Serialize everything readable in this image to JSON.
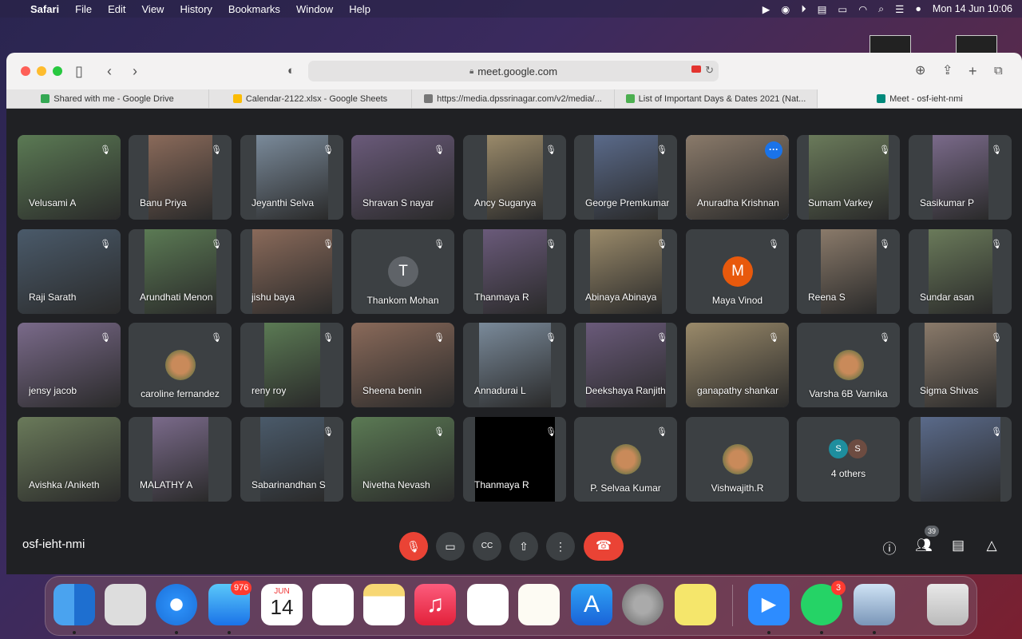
{
  "menubar": {
    "app": "Safari",
    "items": [
      "File",
      "Edit",
      "View",
      "History",
      "Bookmarks",
      "Window",
      "Help"
    ],
    "datetime": "Mon 14 Jun  10:06"
  },
  "browser": {
    "url": "meet.google.com",
    "tabs": [
      {
        "label": "Shared with me - Google Drive",
        "color": "#34a853"
      },
      {
        "label": "Calendar-2122.xlsx - Google Sheets",
        "color": "#fbbc04"
      },
      {
        "label": "https://media.dpssrinagar.com/v2/media/...",
        "color": "#777777"
      },
      {
        "label": "List of Important Days & Dates 2021 (Nat...",
        "color": "#4caf50"
      },
      {
        "label": "Meet - osf-ieht-nmi",
        "color": "#00897b"
      }
    ]
  },
  "meet": {
    "code": "osf-ieht-nmi",
    "participant_count": "39",
    "participants": [
      {
        "name": "Velusami A"
      },
      {
        "name": "Banu Priya"
      },
      {
        "name": "Jeyanthi Selva"
      },
      {
        "name": "Shravan S nayar"
      },
      {
        "name": "Ancy Suganya"
      },
      {
        "name": "George Premkumar"
      },
      {
        "name": "Anuradha Krishnan"
      },
      {
        "name": "Sumam Varkey"
      },
      {
        "name": "Sasikumar P"
      },
      {
        "name": "Raji Sarath"
      },
      {
        "name": "Arundhati Menon"
      },
      {
        "name": "jishu baya"
      },
      {
        "name": "Thankom Mohan",
        "initial": "T"
      },
      {
        "name": "Thanmaya R"
      },
      {
        "name": "Abinaya Abinaya"
      },
      {
        "name": "Maya Vinod",
        "initial": "M"
      },
      {
        "name": "Reena S"
      },
      {
        "name": "Sundar asan"
      },
      {
        "name": "jensy jacob"
      },
      {
        "name": "caroline fernandez"
      },
      {
        "name": "reny roy"
      },
      {
        "name": "Sheena benin"
      },
      {
        "name": "Annadurai L"
      },
      {
        "name": "Deekshaya Ranjith"
      },
      {
        "name": "ganapathy shankar"
      },
      {
        "name": "Varsha 6B Varnika"
      },
      {
        "name": "Sigma Shivas"
      },
      {
        "name": "Avishka /Aniketh"
      },
      {
        "name": "MALATHY A"
      },
      {
        "name": "Sabarinandhan S"
      },
      {
        "name": "Nivetha Nevash"
      },
      {
        "name": "Thanmaya R"
      },
      {
        "name": "P. Selvaa Kumar"
      },
      {
        "name": "Vishwajith.R"
      },
      {
        "name": "4 others",
        "initials": [
          "S",
          "S"
        ]
      },
      {
        "name": ""
      }
    ]
  },
  "dock": {
    "mail_badge": "976",
    "calendar_month": "JUN",
    "calendar_day": "14",
    "whatsapp_badge": "3"
  }
}
